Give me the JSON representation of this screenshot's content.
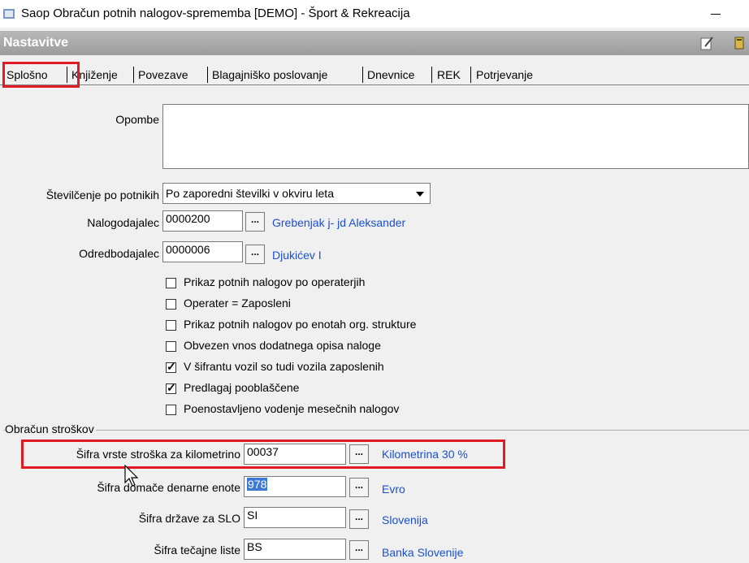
{
  "window": {
    "title": "Saop Obračun potnih nalogov-sprememba [DEMO] - Šport & Rekreacija",
    "icons": [
      "app-icon",
      "minimize-icon"
    ]
  },
  "header": {
    "title": "Nastavitve",
    "icons": [
      "edit-icon",
      "bookmark-icon"
    ]
  },
  "tabs": [
    {
      "label": "Splošno",
      "active": true
    },
    {
      "label": "Knjiženje"
    },
    {
      "label": "Povezave"
    },
    {
      "label": "Blagajniško poslovanje"
    },
    {
      "label": "Dnevnice"
    },
    {
      "label": "REK"
    },
    {
      "label": "Potrjevanje"
    }
  ],
  "form": {
    "opombe_label": "Opombe",
    "opombe_value": "",
    "stevilcenje_label": "Številčenje po potnikih",
    "stevilcenje_value": "Po zaporedni številki v okviru leta",
    "nalogodajalec_label": "Nalogodajalec",
    "nalogodajalec_code": "0000200",
    "nalogodajalec_name": "Grebenjak j- jd Aleksander",
    "odredbodajalec_label": "Odredbodajalec",
    "odredbodajalec_code": "0000006",
    "odredbodajalec_name": "Djukićev I",
    "lookup_button": "...",
    "checkboxes": [
      {
        "label": "Prikaz potnih nalogov po operaterjih",
        "checked": false
      },
      {
        "label": "Operater = Zaposleni",
        "checked": false
      },
      {
        "label": "Prikaz potnih nalogov po enotah org. strukture",
        "checked": false
      },
      {
        "label": "Obvezen vnos dodatnega opisa naloge",
        "checked": false
      },
      {
        "label": "V šifrantu vozil  so tudi vozila zaposlenih",
        "checked": true
      },
      {
        "label": "Predlagaj pooblaščene",
        "checked": true
      },
      {
        "label": "Poenostavljeno vodenje mesečnih nalogov",
        "checked": false
      }
    ]
  },
  "obracun": {
    "group_title": "Obračun stroškov",
    "kilometrina_label": "Šifra vrste stroška za kilometrino",
    "kilometrina_code": "00037",
    "kilometrina_name": "Kilometrina 30 %",
    "valuta_label": "Šifra domače denarne enote",
    "valuta_code": "978",
    "valuta_name": "Evro",
    "drzava_label": "Šifra države za SLO",
    "drzava_code": "SI",
    "drzava_name": "Slovenija",
    "tecajna_label": "Šifra tečajne liste",
    "tecajna_code": "BS",
    "tecajna_name": "Banka Slovenije"
  },
  "colors": {
    "highlight_border": "#e01b24",
    "link_text": "#1a4fd1",
    "header_band": "#a8a8a8",
    "selection": "#3a79d6"
  }
}
